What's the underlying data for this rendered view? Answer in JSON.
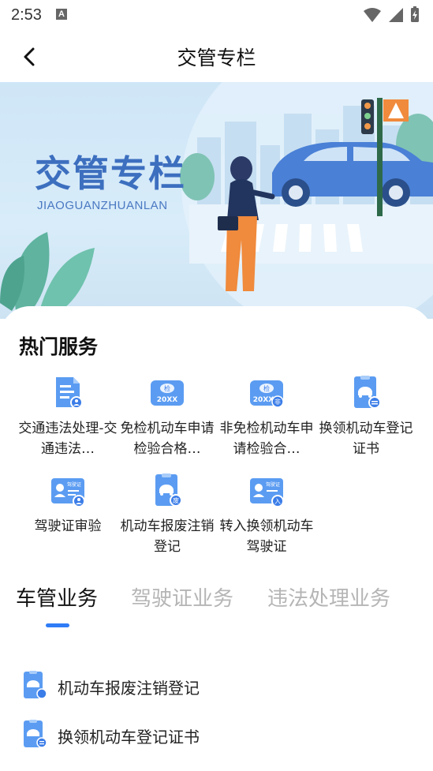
{
  "status": {
    "time": "2:53",
    "notif": "A"
  },
  "nav": {
    "title": "交管专栏"
  },
  "banner": {
    "title": "交管专栏",
    "subtitle": "JIAOGUANZHUANLAN"
  },
  "hot": {
    "title": "热门服务",
    "items": [
      {
        "label": "交通违法处理-交通违法…",
        "icon": "document-icon"
      },
      {
        "label": "免检机动车申请检验合格…",
        "icon": "inspection-badge-icon",
        "badge": "检",
        "sub": "20XX"
      },
      {
        "label": "非免检机动车申请检验合…",
        "icon": "inspection-badge-icon",
        "badge": "检",
        "sub": "20XX",
        "corner": "非"
      },
      {
        "label": "换领机动车登记证书",
        "icon": "car-certificate-icon"
      },
      {
        "label": "驾驶证审验",
        "icon": "driver-license-icon",
        "tag": "驾驶证"
      },
      {
        "label": "机动车报废注销登记",
        "icon": "car-scrap-icon",
        "corner": "废"
      },
      {
        "label": "转入换领机动车驾驶证",
        "icon": "driver-license-icon",
        "tag": "驾驶证",
        "corner": "入"
      }
    ]
  },
  "tabs": [
    {
      "label": "车管业务",
      "active": true
    },
    {
      "label": "驾驶证业务",
      "active": false
    },
    {
      "label": "违法处理业务",
      "active": false
    }
  ],
  "list": [
    {
      "label": "机动车报废注销登记",
      "icon": "car-scrap-icon"
    },
    {
      "label": "换领机动车登记证书",
      "icon": "car-certificate-icon"
    }
  ],
  "colors": {
    "accent": "#2f7cf6",
    "banner_text": "#3d6fbf",
    "icon_blue": "#4a8ff0"
  }
}
